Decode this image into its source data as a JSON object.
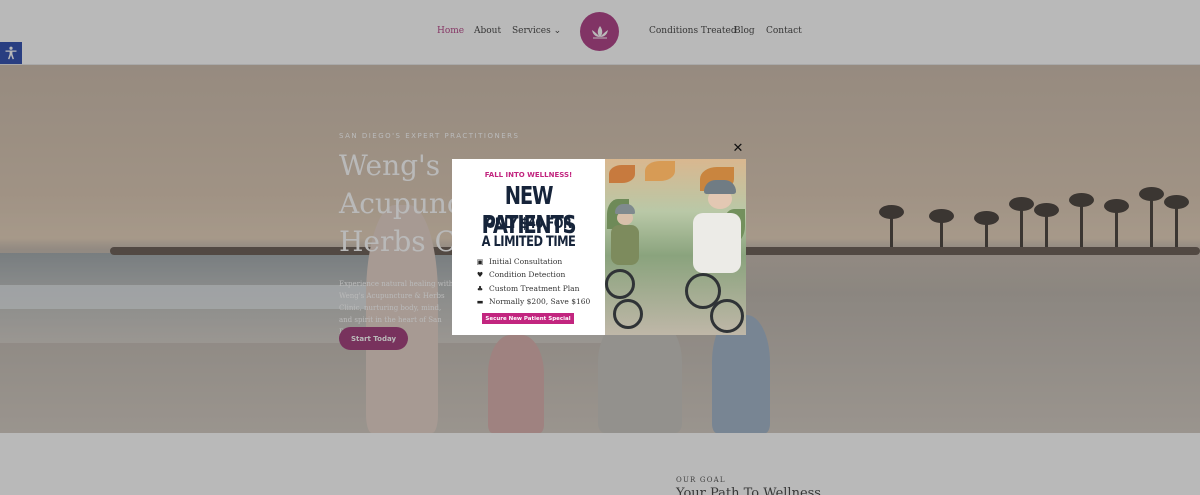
{
  "nav": {
    "items_left": [
      "Home",
      "About",
      "Services"
    ],
    "items_right": [
      "Conditions Treated",
      "Blog",
      "Contact"
    ],
    "services_chevron": "⌄"
  },
  "hero": {
    "tagline": "SAN DIEGO'S EXPERT PRACTITIONERS",
    "title_line1": "Weng's",
    "title_line2": "Acupuncture &",
    "title_line3": "Herbs Clinic",
    "description": "Experience natural healing with Weng's Acupuncture & Herbs Clinic, nurturing body, mind, and spirit in the heart of San Diego.",
    "cta_label": "Start Today"
  },
  "goal": {
    "kicker": "OUR GOAL",
    "title": "Your Path To Wellness"
  },
  "modal": {
    "kicker": "FALL INTO WELLNESS!",
    "headline": "NEW PATIENTS",
    "offer_line1": "ONLY $40 FOR",
    "offer_line2": "A LIMITED TIME",
    "benefits": [
      {
        "icon": "clipboard-check-icon",
        "glyph": "▣",
        "text": "Initial Consultation"
      },
      {
        "icon": "heart-pulse-icon",
        "glyph": "♥",
        "text": "Condition Detection"
      },
      {
        "icon": "hand-holding-heart-icon",
        "glyph": "♣",
        "text": "Custom Treatment Plan"
      },
      {
        "icon": "money-bill-icon",
        "glyph": "▬",
        "text": "Normally $200, Save $160"
      }
    ],
    "button_label": "Secure New Patient Special",
    "close_glyph": "✕"
  },
  "colors": {
    "brand_magenta": "#a82f7c",
    "cta_purple": "#9a2d6f",
    "modal_pink": "#c2257f",
    "headline_navy": "#16243a",
    "a11y_blue": "#1f3fa8"
  }
}
